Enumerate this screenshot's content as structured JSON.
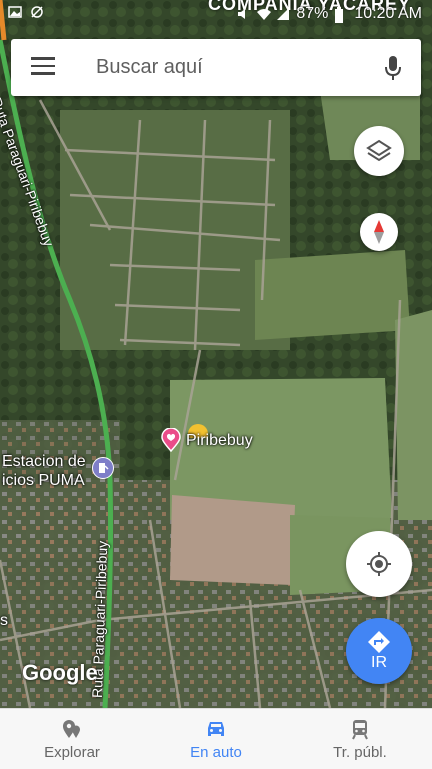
{
  "status": {
    "carrier_text": "COMPANIA YACAREY",
    "battery": "87%",
    "time": "10:20 AM"
  },
  "search": {
    "placeholder": "Buscar aquí"
  },
  "map": {
    "place_label": "Piribebuy",
    "poi_label_line1": "Estacion de",
    "poi_label_line2": "icios PUMA",
    "route_label_top": "Ruta Paraguari-Piribebuy",
    "route_label_bottom": "Ruta Paraguari-Piribebuy",
    "edge_label": "s",
    "attribution": "Google"
  },
  "fabs": {
    "go_label": "IR"
  },
  "bottom_nav": {
    "items": [
      {
        "label": "Explorar",
        "active": false
      },
      {
        "label": "En auto",
        "active": true
      },
      {
        "label": "Tr. públ.",
        "active": false
      }
    ]
  },
  "colors": {
    "accent": "#4285f4",
    "pin": "#ea4c89",
    "route": "#4caf50"
  }
}
